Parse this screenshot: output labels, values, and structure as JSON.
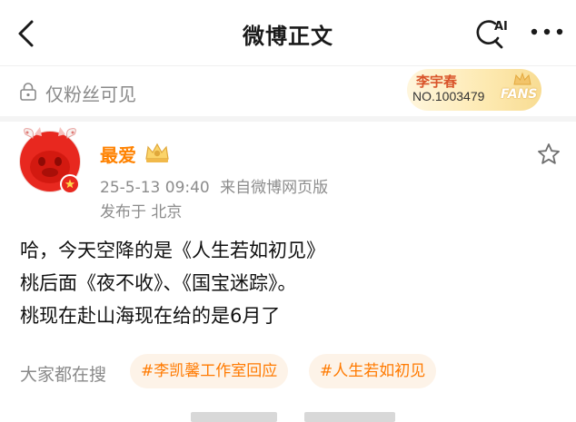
{
  "header": {
    "title": "微博正文",
    "ai_label": "AI"
  },
  "visibility": {
    "label": "仅粉丝可见"
  },
  "fans_badge": {
    "name": "李宇春",
    "number": "NO.1003479",
    "word": "FANS"
  },
  "post": {
    "author": "最爱",
    "date": "25-5-13 09:40",
    "source": "来自微博网页版",
    "location": "发布于 北京",
    "lines": [
      "哈，今天空降的是《人生若如初见》",
      "桃后面《夜不收》、《国宝迷踪》。",
      "桃现在赴山海现在给的是6月了"
    ]
  },
  "search": {
    "label": "大家都在搜",
    "tags": [
      "#李凯馨工作室回应",
      "#人生若如初见"
    ]
  },
  "colors": {
    "accent": "#ff8200",
    "tag_bg": "#fdf3e8",
    "meta": "#8c8c8c"
  },
  "icons": [
    "back-arrow-icon",
    "ai-search-icon",
    "more-icon",
    "lock-eye-icon",
    "crown-icon",
    "vip-crown-icon",
    "star-icon",
    "verified-badge-icon"
  ]
}
